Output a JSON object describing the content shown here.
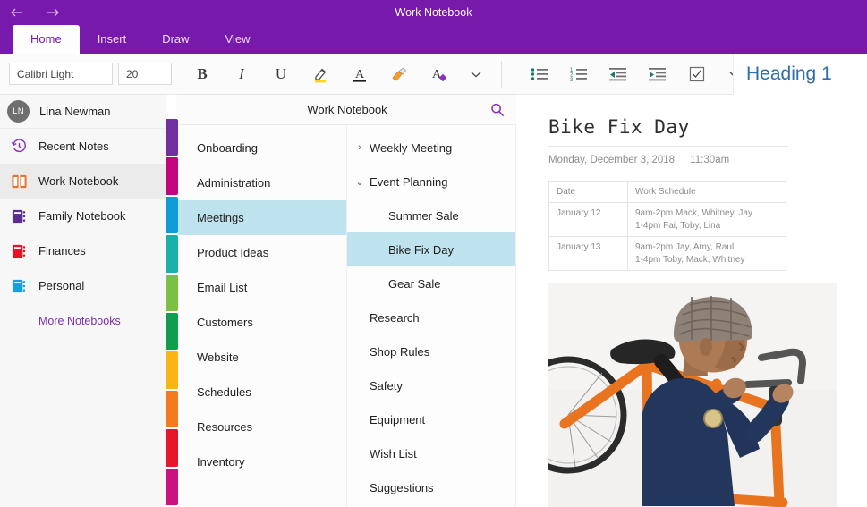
{
  "window": {
    "title": "Work Notebook",
    "back_icon": "arrow-left-icon",
    "forward_icon": "arrow-right-icon",
    "accent_color": "#7719aa"
  },
  "ribbon": {
    "tabs": [
      {
        "label": "Home",
        "active": true
      },
      {
        "label": "Insert",
        "active": false
      },
      {
        "label": "Draw",
        "active": false
      },
      {
        "label": "View",
        "active": false
      }
    ],
    "font_name": "Calibri Light",
    "font_size": "20",
    "buttons": [
      {
        "name": "bold-button",
        "label": "B"
      },
      {
        "name": "italic-button",
        "label": "I"
      },
      {
        "name": "underline-button",
        "label": "U"
      },
      {
        "name": "highlighter-icon",
        "label": ""
      },
      {
        "name": "font-color-icon",
        "label": ""
      },
      {
        "name": "format-painter-icon",
        "label": ""
      },
      {
        "name": "clear-formatting-icon",
        "label": ""
      },
      {
        "name": "chevron-down-icon",
        "label": "⌄"
      }
    ],
    "list_buttons": [
      {
        "name": "bullet-list-icon"
      },
      {
        "name": "numbered-list-icon"
      },
      {
        "name": "decrease-indent-icon"
      },
      {
        "name": "increase-indent-icon"
      },
      {
        "name": "todo-checkbox-icon"
      },
      {
        "name": "chevron-down-icon"
      }
    ],
    "style_name": "Heading 1",
    "style_color": "#2f6fa8"
  },
  "sidebar": {
    "user": {
      "initials": "LN",
      "name": "Lina Newman"
    },
    "items": [
      {
        "label": "Recent Notes",
        "icon": "recent-clock-icon",
        "color": "#8a2fc0",
        "selected": false
      },
      {
        "label": "Work Notebook",
        "icon": "open-book-icon",
        "color": "#e8722a",
        "selected": true
      },
      {
        "label": "Family Notebook",
        "icon": "notebook-icon",
        "color": "#5a2d91",
        "selected": false
      },
      {
        "label": "Finances",
        "icon": "notebook-icon",
        "color": "#e81123",
        "selected": false
      },
      {
        "label": "Personal",
        "icon": "notebook-icon",
        "color": "#14a0e0",
        "selected": false
      }
    ],
    "more_label": "More Notebooks",
    "more_color": "#7b2fae",
    "section_tab_colors": [
      "#7030a0",
      "#c4047f",
      "#0f9bd7",
      "#18b0a8",
      "#7ac143",
      "#0f9d4f",
      "#fcb415",
      "#f5791f",
      "#e8162a",
      "#c9137e"
    ]
  },
  "panel": {
    "title": "Work Notebook",
    "search_icon": "search-icon",
    "sections": [
      {
        "label": "Onboarding",
        "selected": false
      },
      {
        "label": "Administration",
        "selected": false
      },
      {
        "label": "Meetings",
        "selected": true
      },
      {
        "label": "Product Ideas",
        "selected": false
      },
      {
        "label": "Email List",
        "selected": false
      },
      {
        "label": "Customers",
        "selected": false
      },
      {
        "label": "Website",
        "selected": false
      },
      {
        "label": "Schedules",
        "selected": false
      },
      {
        "label": "Resources",
        "selected": false
      },
      {
        "label": "Inventory",
        "selected": false
      }
    ],
    "pages": [
      {
        "label": "Weekly Meeting",
        "chevron": "›",
        "indent": 0,
        "selected": false
      },
      {
        "label": "Event Planning",
        "chevron": "⌄",
        "indent": 0,
        "selected": false
      },
      {
        "label": "Summer Sale",
        "chevron": "",
        "indent": 1,
        "selected": false
      },
      {
        "label": "Bike Fix Day",
        "chevron": "",
        "indent": 1,
        "selected": true
      },
      {
        "label": "Gear Sale",
        "chevron": "",
        "indent": 1,
        "selected": false
      },
      {
        "label": "Research",
        "chevron": "",
        "indent": 0,
        "selected": false
      },
      {
        "label": "Shop Rules",
        "chevron": "",
        "indent": 0,
        "selected": false
      },
      {
        "label": "Safety",
        "chevron": "",
        "indent": 0,
        "selected": false
      },
      {
        "label": "Equipment",
        "chevron": "",
        "indent": 0,
        "selected": false
      },
      {
        "label": "Wish List",
        "chevron": "",
        "indent": 0,
        "selected": false
      },
      {
        "label": "Suggestions",
        "chevron": "",
        "indent": 0,
        "selected": false
      }
    ]
  },
  "note": {
    "title": "Bike Fix Day",
    "date": "Monday, December 3, 2018",
    "time": "11:30am",
    "table": {
      "headers": [
        "Date",
        "Work Schedule"
      ],
      "rows": [
        {
          "date": "January 12",
          "line1": "9am-2pm Mack, Whitney, Jay",
          "line2": "1-4pm Fai, Toby, Lina"
        },
        {
          "date": "January 13",
          "line1": "9am-2pm Jay, Amy, Raul",
          "line2": "1-4pm Toby, Mack, Whitney"
        }
      ]
    },
    "image_alt": "man carrying orange bicycle frame on shoulder"
  }
}
